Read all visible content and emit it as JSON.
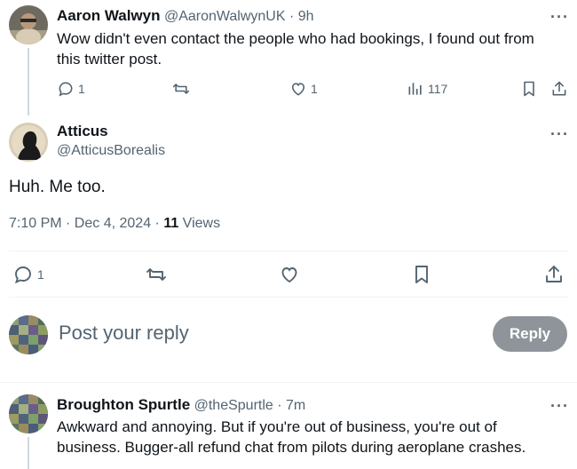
{
  "tweet1": {
    "name": "Aaron Walwyn",
    "handle": "@AaronWalwynUK",
    "time": "9h",
    "text_line1": "Wow didn't even contact the people who had bookings, I found out from",
    "text_line2": "this twitter post.",
    "replies": "1",
    "likes": "1",
    "views": "117"
  },
  "main": {
    "name": "Atticus",
    "handle": "@AtticusBorealis",
    "text": "Huh. Me too.",
    "timestamp": "7:10 PM · Dec 4, 2024 · ",
    "views_count": "11",
    "views_label": " Views",
    "replies": "1"
  },
  "compose": {
    "placeholder": "Post your reply",
    "reply_button": "Reply"
  },
  "tweet3": {
    "name": "Broughton Spurtle",
    "handle": "@theSpurtle",
    "time": "7m",
    "text_line1": "Awkward and annoying. But if you're out of business, you're out of",
    "text_line2": "business. Bugger-all refund chat from pilots during aeroplane crashes."
  },
  "more_glyph": "···",
  "handle_sep": " · ",
  "colors": {
    "text": "#0f1419",
    "muted": "#536471",
    "reply_btn": "#8e9499",
    "line": "#cfd9de"
  }
}
